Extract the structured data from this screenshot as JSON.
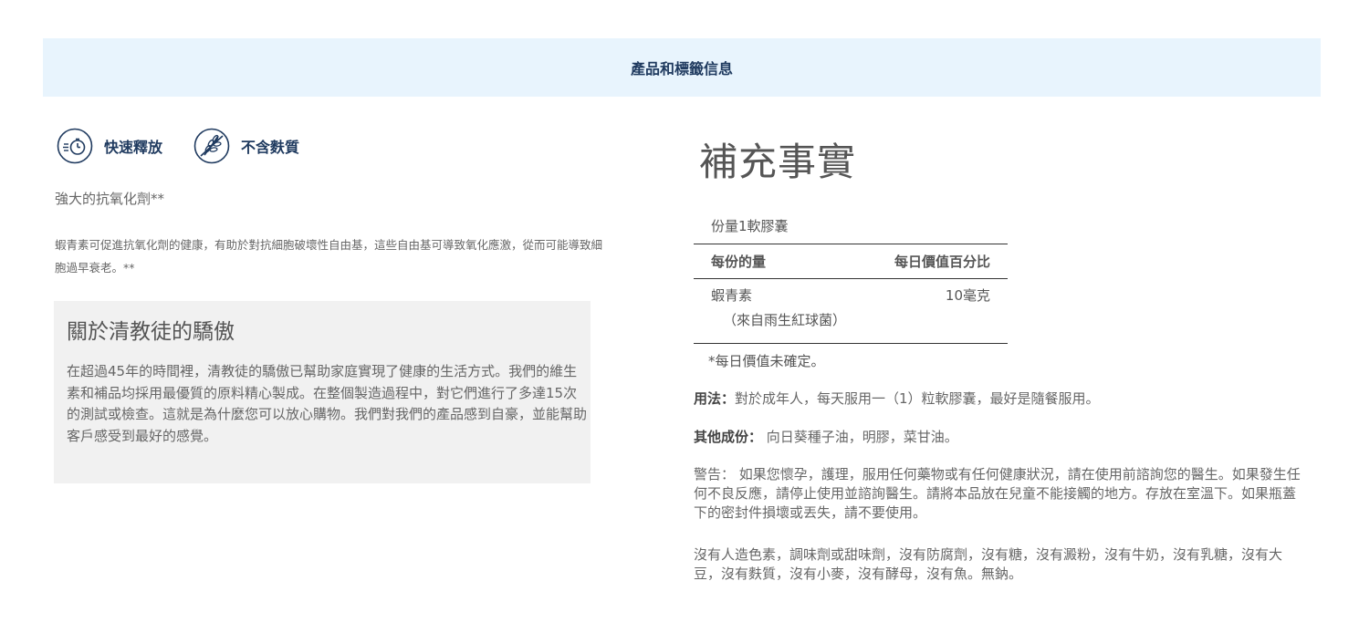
{
  "header": {
    "title": "產品和標籤信息"
  },
  "badges": [
    {
      "label": "快速釋放",
      "icon": "stopwatch-icon"
    },
    {
      "label": "不含麩質",
      "icon": "gluten-free-icon"
    }
  ],
  "antioxidant": {
    "title": "強大的抗氧化劑**",
    "description": "蝦青素可促進抗氧化劑的健康，有助於對抗細胞破壞性自由基，這些自由基可導致氧化應激，從而可能導致細胞過早衰老。**"
  },
  "about": {
    "title": "關於清教徒的驕傲",
    "text": "在超過45年的時間裡，清教徒的驕傲已幫助家庭實現了健康的生活方式。我們的維生素和補品均採用最優質的原料精心製成。在整個製造過程中，對它們進行了多達15次的測試或檢查。這就是為什麼您可以放心購物。我們對我們的產品感到自豪，並能幫助客戶感受到最好的感覺。"
  },
  "facts": {
    "title": "補充事實",
    "serving": "份量1軟膠囊",
    "col_amount": "每份的量",
    "col_dv": "每日價值百分比",
    "ingredient_name": "蝦青素",
    "ingredient_amount": "10毫克",
    "ingredient_source": "（來自雨生紅球菌）",
    "footnote": "*每日價值未確定。"
  },
  "usage": {
    "label": "用法：",
    "text": "對於成年人，每天服用一（1）粒軟膠囊，最好是隨餐服用。"
  },
  "other": {
    "label": "其他成份：",
    "text": " 向日葵種子油，明膠，菜甘油。"
  },
  "warning": "警告： 如果您懷孕，護理，服用任何藥物或有任何健康狀況，請在使用前諮詢您的醫生。如果發生任何不良反應，請停止使用並諮詢醫生。請將本品放在兒童不能接觸的地方。存放在室溫下。如果瓶蓋下的密封件損壞或丟失，請不要使用。",
  "free_from": "沒有人造色素，調味劑或甜味劑，沒有防腐劑，沒有糖，沒有澱粉，沒有牛奶，沒有乳糖，沒有大豆，沒有麩質，沒有小麥，沒有酵母，沒有魚。無鈉。",
  "colors": {
    "header_bg": "#e8f4fd",
    "brand_navy": "#1f3a5f",
    "about_bg": "#f1f1f1"
  }
}
